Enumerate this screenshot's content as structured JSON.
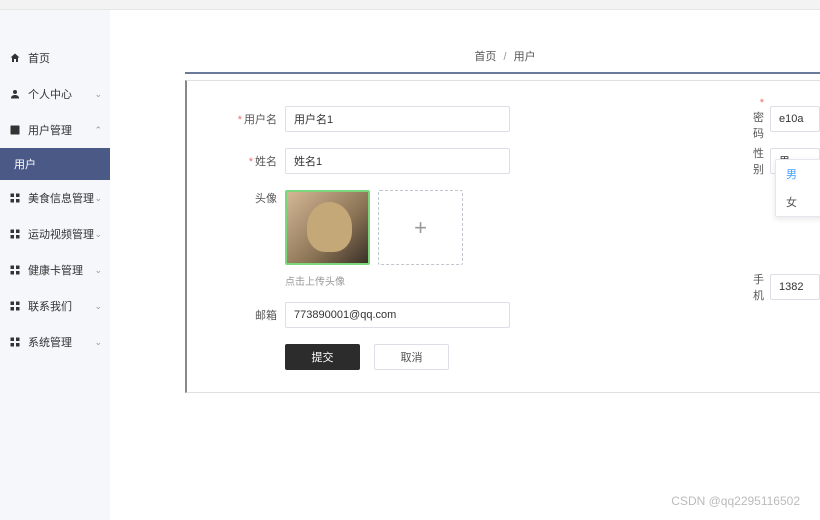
{
  "sidebar": {
    "items": [
      {
        "label": "首页",
        "icon": "home"
      },
      {
        "label": "个人中心",
        "icon": "user",
        "expandable": true
      },
      {
        "label": "用户管理",
        "icon": "grid",
        "expandable": true,
        "expanded": true
      },
      {
        "label": "美食信息管理",
        "icon": "grid",
        "expandable": true
      },
      {
        "label": "运动视频管理",
        "icon": "grid",
        "expandable": true
      },
      {
        "label": "健康卡管理",
        "icon": "grid",
        "expandable": true
      },
      {
        "label": "联系我们",
        "icon": "grid",
        "expandable": true
      },
      {
        "label": "系统管理",
        "icon": "grid",
        "expandable": true
      }
    ],
    "sub_item": "用户"
  },
  "breadcrumb": {
    "home": "首页",
    "current": "用户"
  },
  "form": {
    "username_label": "用户名",
    "username_value": "用户名1",
    "name_label": "姓名",
    "name_value": "姓名1",
    "avatar_label": "头像",
    "upload_hint": "点击上传头像",
    "email_label": "邮箱",
    "email_value": "773890001@qq.com",
    "password_label": "密码",
    "password_value": "e10a",
    "gender_label": "性别",
    "gender_value": "男",
    "gender_options": [
      "男",
      "女"
    ],
    "phone_label": "手机",
    "phone_value": "1382",
    "submit_label": "提交",
    "cancel_label": "取消"
  },
  "watermark": "CSDN @qq2295116502"
}
